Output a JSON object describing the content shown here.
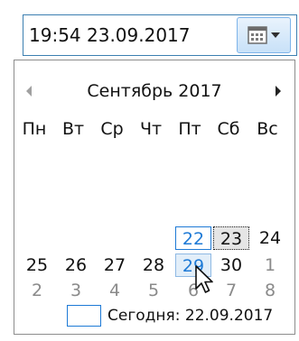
{
  "datetime_field": {
    "value": "19:54 23.09.2017",
    "button_icon": "calendar-icon"
  },
  "calendar": {
    "prev_icon": "chevron-left-icon",
    "next_icon": "chevron-right-icon",
    "month_title": "Сентябрь 2017",
    "weekdays": [
      "Пн",
      "Вт",
      "Ср",
      "Чт",
      "Пт",
      "Сб",
      "Вс"
    ],
    "weeks": [
      [
        null,
        null,
        null,
        null,
        null,
        null,
        null
      ],
      [
        null,
        null,
        null,
        null,
        null,
        null,
        null
      ],
      [
        null,
        null,
        null,
        null,
        "22",
        "23",
        "24"
      ],
      [
        "25",
        "26",
        "27",
        "28",
        "29",
        "30",
        "1"
      ],
      [
        "2",
        "3",
        "4",
        "5",
        "6",
        "7",
        "8"
      ]
    ],
    "today_label": "Сегодня: 22.09.2017",
    "colors": {
      "today_border": "#1e7ad6",
      "hover_background": "#e2eef9",
      "selected_background": "#e5e5e5",
      "other_month_text": "#8a8a8a"
    }
  }
}
